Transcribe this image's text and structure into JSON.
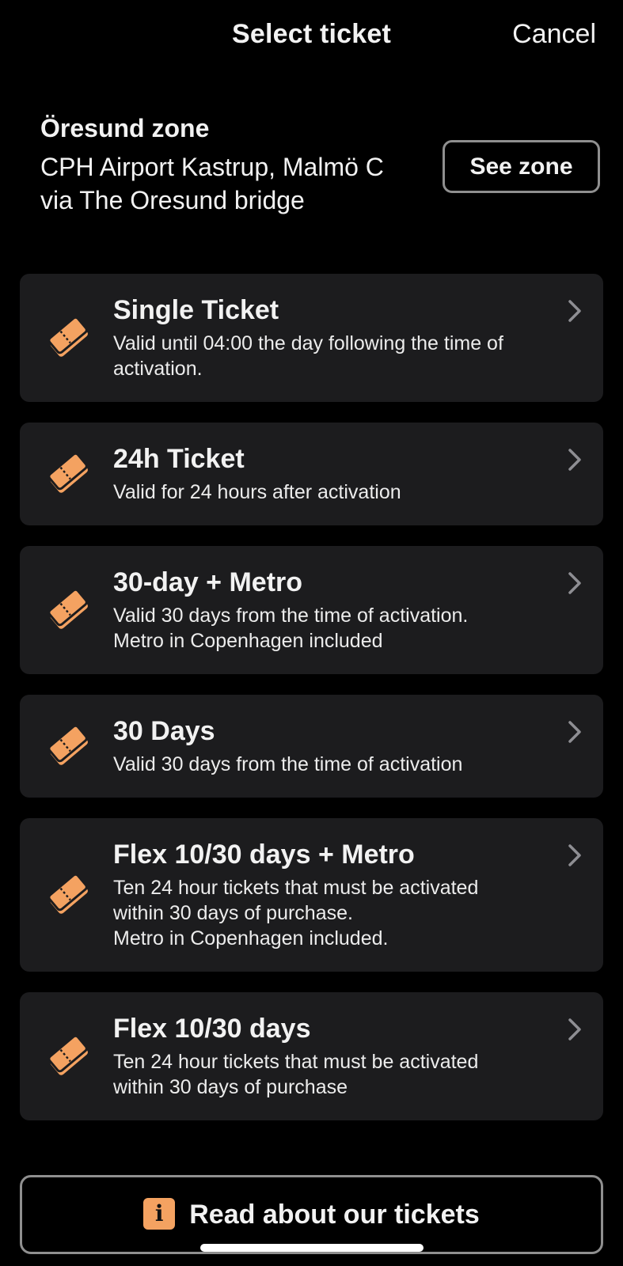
{
  "nav": {
    "title": "Select ticket",
    "cancel_label": "Cancel"
  },
  "zone": {
    "title": "Öresund zone",
    "description": "CPH Airport Kastrup, Malmö C\nvia The Oresund bridge",
    "see_zone_label": "See zone"
  },
  "tickets": [
    {
      "title": "Single Ticket",
      "description": "Valid until 04:00 the day following the time of\nactivation.",
      "icon": "ticket-icon"
    },
    {
      "title": "24h Ticket",
      "description": "Valid for 24 hours after activation",
      "icon": "ticket-icon"
    },
    {
      "title": "30-day + Metro",
      "description": "Valid 30 days from the time of activation.\nMetro in Copenhagen included",
      "icon": "ticket-icon"
    },
    {
      "title": "30 Days",
      "description": "Valid 30 days from the time of activation",
      "icon": "ticket-icon"
    },
    {
      "title": "Flex 10/30 days + Metro",
      "description": "Ten 24 hour tickets that must be activated\nwithin 30 days of purchase.\nMetro in Copenhagen included.",
      "icon": "ticket-icon"
    },
    {
      "title": "Flex 10/30 days",
      "description": "Ten 24 hour tickets that must be activated\nwithin 30 days of purchase",
      "icon": "ticket-icon"
    }
  ],
  "footer": {
    "read_about_label": "Read about our tickets",
    "info_icon_glyph": "i",
    "icon": "info-icon"
  },
  "colors": {
    "background": "#000000",
    "card": "#1c1c1e",
    "accent": "#f4a261",
    "border": "#8f8f8f"
  }
}
